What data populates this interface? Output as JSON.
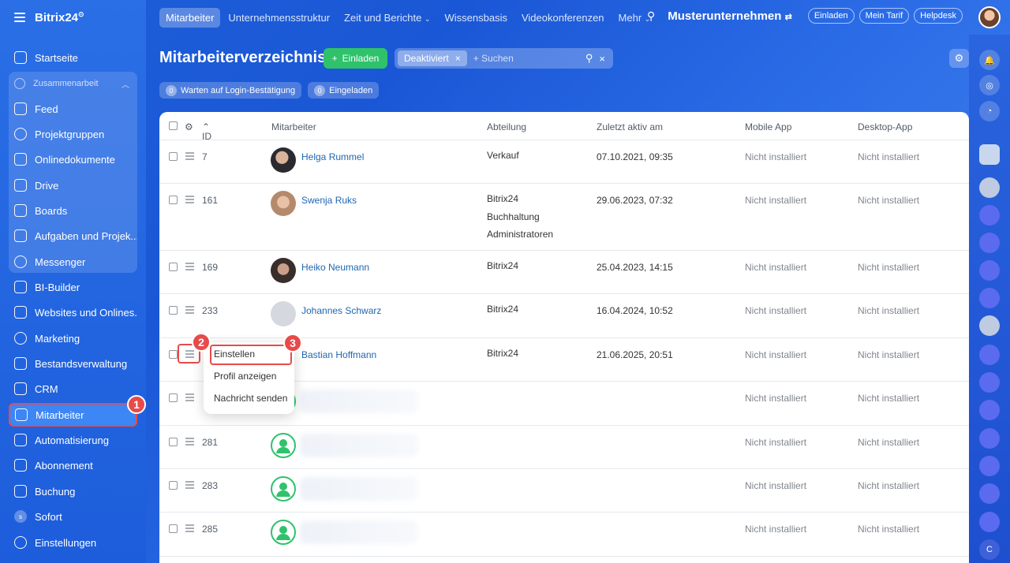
{
  "app": {
    "logo": "Bitrix24",
    "logo_mark": "⊙"
  },
  "sidebar": {
    "top": "Startseite",
    "group": "Zusammenarbeit",
    "group_items": [
      "Feed",
      "Projektgruppen",
      "Onlinedokumente",
      "Drive",
      "Boards",
      "Aufgaben und Projek...",
      "Messenger"
    ],
    "items": [
      "BI-Builder",
      "Websites und Onlines...",
      "Marketing",
      "Bestandsverwaltung",
      "CRM",
      "Mitarbeiter",
      "Automatisierung",
      "Abonnement",
      "Buchung",
      "Sofort",
      "Einstellungen"
    ],
    "sofort_letter": "s"
  },
  "topbar": {
    "tabs": [
      "Mitarbeiter",
      "Unternehmensstruktur",
      "Zeit und Berichte",
      "Wissensbasis",
      "Videokonferenzen",
      "Mehr"
    ],
    "company": "Musterunternehmen",
    "invite": "Einladen",
    "tariff": "Mein Tarif",
    "help": "Helpdesk"
  },
  "page": {
    "title": "Mitarbeiterverzeichnis",
    "invite_btn": "Einladen",
    "filter_tag": "Deaktiviert",
    "search_placeholder": "+ Suchen",
    "f1_count": "0",
    "f1_label": "Warten auf Login-Bestätigung",
    "f2_count": "0",
    "f2_label": "Eingeladen"
  },
  "table": {
    "headers": {
      "id": "ID",
      "employee": "Mitarbeiter",
      "dept": "Abteilung",
      "last": "Zuletzt aktiv am",
      "mobile": "Mobile App",
      "desktop": "Desktop-App"
    },
    "rows": [
      {
        "id": "7",
        "name": "Helga Rummel",
        "dept": [
          "Verkauf"
        ],
        "last": "07.10.2021, 09:35",
        "mobile": "Nicht installiert",
        "desktop": "Nicht installiert"
      },
      {
        "id": "161",
        "name": "Swenja Ruks",
        "dept": [
          "Bitrix24",
          "Buchhaltung",
          "Administratoren"
        ],
        "last": "29.06.2023, 07:32",
        "mobile": "Nicht installiert",
        "desktop": "Nicht installiert"
      },
      {
        "id": "169",
        "name": "Heiko Neumann",
        "dept": [
          "Bitrix24"
        ],
        "last": "25.04.2023, 14:15",
        "mobile": "Nicht installiert",
        "desktop": "Nicht installiert"
      },
      {
        "id": "233",
        "name": "Johannes Schwarz",
        "dept": [
          "Bitrix24"
        ],
        "last": "16.04.2024, 10:52",
        "mobile": "Nicht installiert",
        "desktop": "Nicht installiert"
      },
      {
        "id": "",
        "name": "Bastian Hoffmann",
        "dept": [
          "Bitrix24"
        ],
        "last": "21.06.2025, 20:51",
        "mobile": "Nicht installiert",
        "desktop": "Nicht installiert"
      },
      {
        "id": "",
        "name": "",
        "dept": [],
        "last": "",
        "mobile": "Nicht installiert",
        "desktop": "Nicht installiert"
      },
      {
        "id": "281",
        "name": "",
        "dept": [],
        "last": "",
        "mobile": "Nicht installiert",
        "desktop": "Nicht installiert"
      },
      {
        "id": "283",
        "name": "",
        "dept": [],
        "last": "",
        "mobile": "Nicht installiert",
        "desktop": "Nicht installiert"
      },
      {
        "id": "285",
        "name": "",
        "dept": [],
        "last": "",
        "mobile": "Nicht installiert",
        "desktop": "Nicht installiert"
      }
    ]
  },
  "context_menu": [
    "Einstellen",
    "Profil anzeigen",
    "Nachricht senden"
  ],
  "badges": [
    "1",
    "2",
    "3"
  ],
  "colors": {
    "accent": "#2fc26b",
    "highlight": "#e84a4a",
    "link": "#2067b0"
  }
}
